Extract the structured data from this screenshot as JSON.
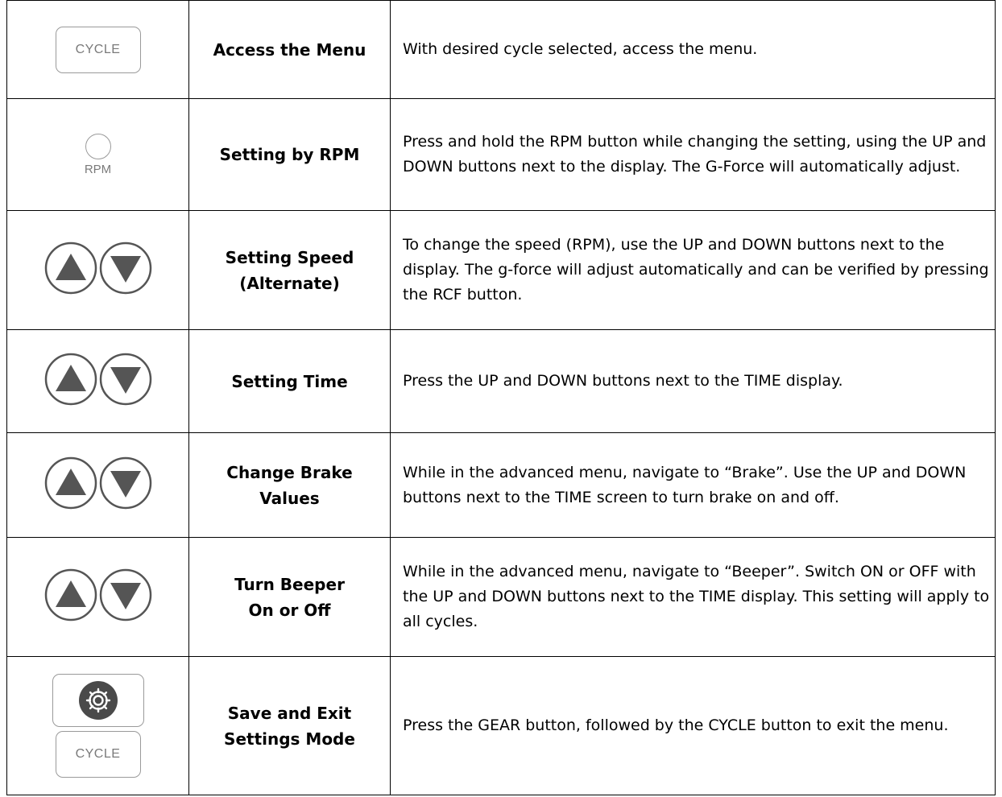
{
  "icons": {
    "cycle_label": "CYCLE",
    "rpm_label": "RPM",
    "arrow_color": "#555555",
    "border_color": "#9a9a9a"
  },
  "rows": [
    {
      "icon": "cycle-button-icon",
      "label_lines": [
        "Access the Menu"
      ],
      "description": "With desired cycle selected, access the menu."
    },
    {
      "icon": "rpm-button-icon",
      "label_lines": [
        "Setting by RPM"
      ],
      "description": "Press and hold the RPM button while changing the setting, using the UP and DOWN buttons next to the display. The G-Force will automatically adjust."
    },
    {
      "icon": "up-down-arrows-icon",
      "label_lines": [
        "Setting Speed",
        "(Alternate)"
      ],
      "description": "To change the speed (RPM), use the UP and DOWN buttons next to the display. The g-force will adjust automatically and can be verified by pressing the RCF button."
    },
    {
      "icon": "up-down-arrows-icon",
      "label_lines": [
        "Setting Time"
      ],
      "description": "Press the UP and DOWN buttons next to the TIME display."
    },
    {
      "icon": "up-down-arrows-icon",
      "label_lines": [
        "Change Brake",
        "Values"
      ],
      "description": "While in the advanced menu, navigate to “Brake”. Use the UP and DOWN buttons next to the TIME screen to turn brake on and off."
    },
    {
      "icon": "up-down-arrows-icon",
      "label_lines": [
        "Turn Beeper",
        "On or Off"
      ],
      "description": "While in the advanced menu, navigate to “Beeper”. Switch ON or OFF with the UP and DOWN buttons next to the TIME display. This setting will apply to all cycles."
    },
    {
      "icon": "gear-and-cycle-buttons-icon",
      "label_lines": [
        "Save and Exit",
        "Settings Mode"
      ],
      "description": "Press the GEAR button, followed by the CYCLE button to exit the menu."
    }
  ]
}
